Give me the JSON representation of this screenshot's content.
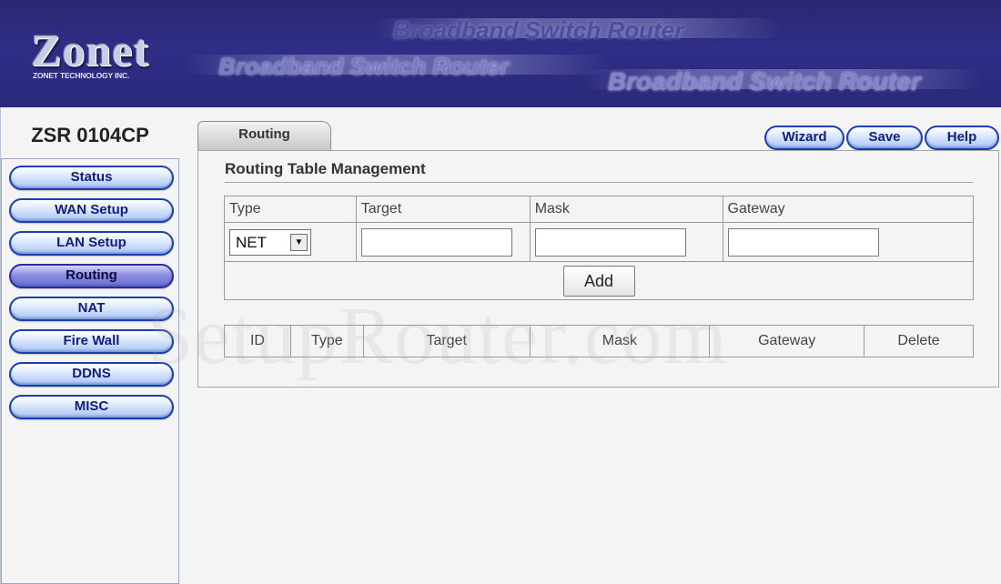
{
  "banner": {
    "logo_word": "Zonet",
    "logo_sub": "ZONET TECHNOLOGY INC.",
    "tagline_1": "Broadband Switch Router",
    "tagline_2": "Broadband Switch Router",
    "tagline_3": "Broadband Switch Router",
    "bg_color": "#2f2d86"
  },
  "sidebar": {
    "model": "ZSR 0104CP",
    "items": [
      {
        "label": "Status"
      },
      {
        "label": "WAN Setup"
      },
      {
        "label": "LAN Setup"
      },
      {
        "label": "Routing",
        "active": true
      },
      {
        "label": "NAT"
      },
      {
        "label": "Fire Wall"
      },
      {
        "label": "DDNS"
      },
      {
        "label": "MISC"
      }
    ]
  },
  "tabs": {
    "active_label": "Routing"
  },
  "toolbar": {
    "wizard_label": "Wizard",
    "save_label": "Save",
    "help_label": "Help"
  },
  "routing": {
    "section_title": "Routing Table Management",
    "form_headers": {
      "type": "Type",
      "target": "Target",
      "mask": "Mask",
      "gateway": "Gateway"
    },
    "type_selected": "NET",
    "target_value": "",
    "mask_value": "",
    "gateway_value": "",
    "add_label": "Add",
    "list_headers": {
      "id": "ID",
      "type": "Type",
      "target": "Target",
      "mask": "Mask",
      "gateway": "Gateway",
      "delete": "Delete"
    }
  },
  "watermark": "SetupRouter.com"
}
